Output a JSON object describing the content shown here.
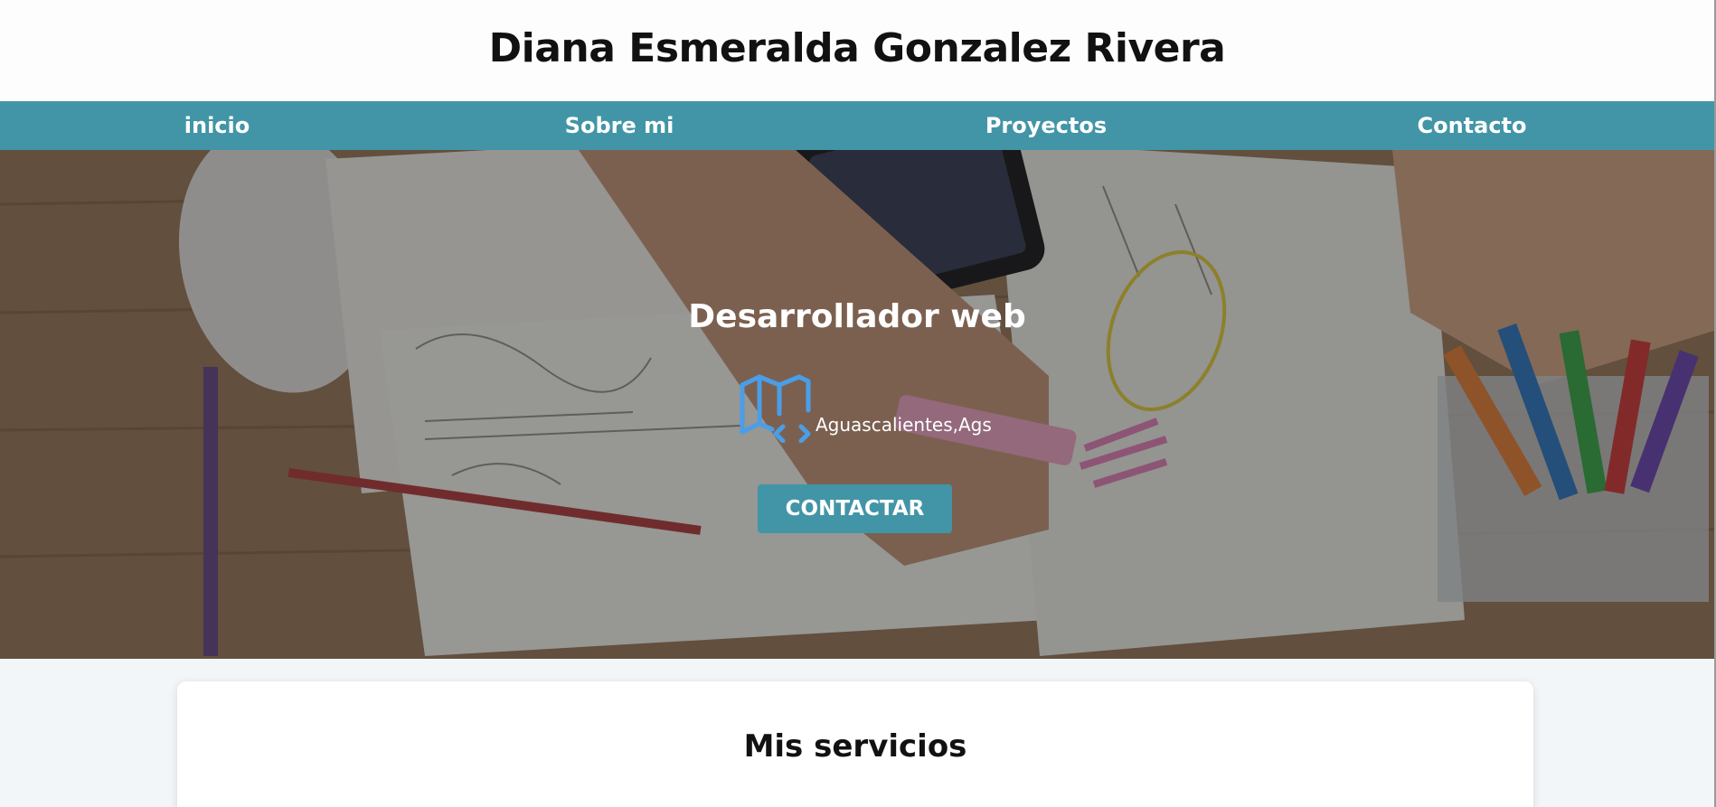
{
  "header": {
    "title": "Diana Esmeralda Gonzalez Rivera"
  },
  "nav": {
    "items": [
      {
        "label": "inicio"
      },
      {
        "label": "Sobre mi"
      },
      {
        "label": "Proyectos"
      },
      {
        "label": "Contacto"
      }
    ],
    "color": "#4295a6"
  },
  "hero": {
    "heading": "Desarrollador web",
    "location": {
      "icon": "map-code-icon",
      "text": "Aguascalientes,Ags"
    },
    "button_label": "CONTACTAR"
  },
  "services": {
    "title": "Mis servicios"
  },
  "colors": {
    "accent": "#4295a6",
    "icon_blue": "#4a9ee8"
  }
}
